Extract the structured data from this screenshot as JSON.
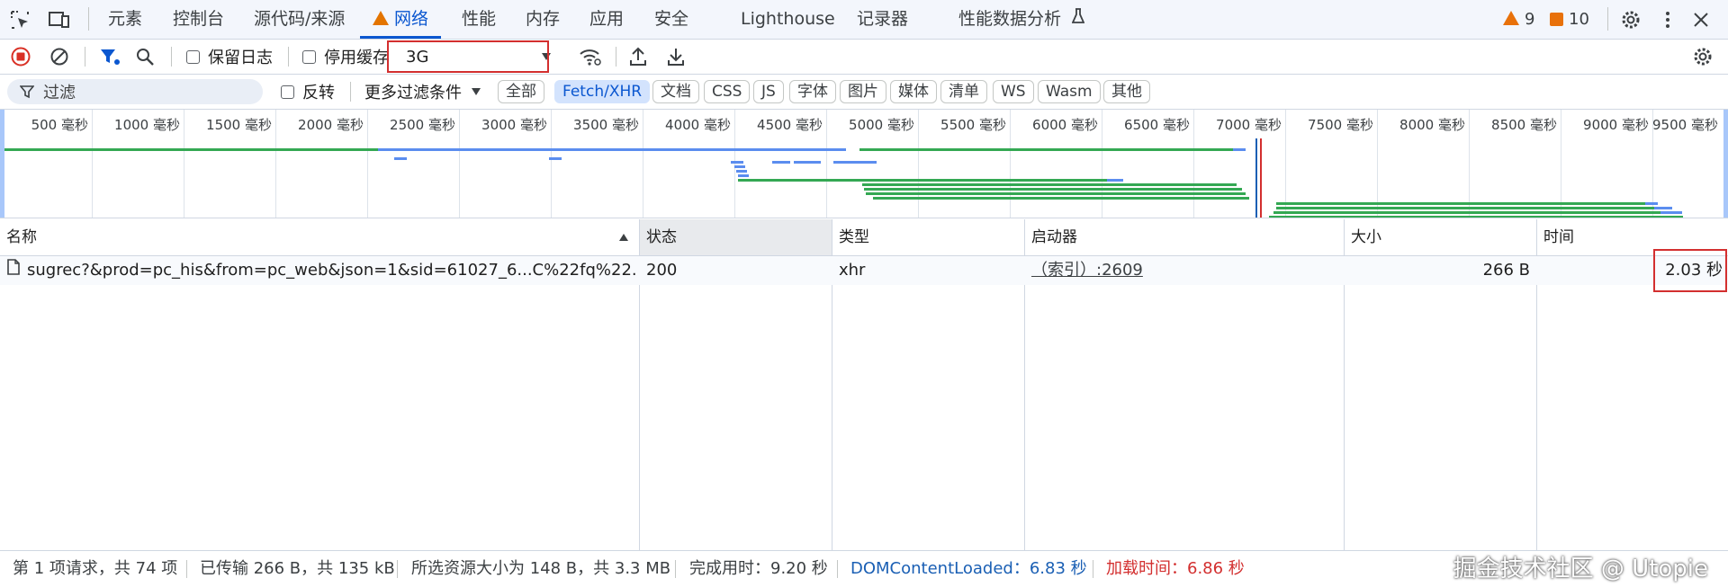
{
  "tabs": {
    "items": [
      {
        "label": "元素"
      },
      {
        "label": "控制台"
      },
      {
        "label": "源代码/来源"
      },
      {
        "label": "网络"
      },
      {
        "label": "性能"
      },
      {
        "label": "内存"
      },
      {
        "label": "应用"
      },
      {
        "label": "安全"
      },
      {
        "label": "Lighthouse"
      },
      {
        "label": "记录器"
      },
      {
        "label": "性能数据分析"
      }
    ],
    "active_tab": "网络",
    "warnings_count": "9",
    "issues_count": "10"
  },
  "toolbar": {
    "preserve_log_label": "保留日志",
    "disable_cache_label": "停用缓存",
    "throttling_value": "3G"
  },
  "filterbar": {
    "filter_placeholder": "过滤",
    "invert_label": "反转",
    "more_filters_label": "更多过滤条件",
    "type_chips": [
      {
        "label": "全部",
        "active": false
      },
      {
        "label": "Fetch/XHR",
        "active": true
      },
      {
        "label": "文档",
        "active": false
      },
      {
        "label": "CSS",
        "active": false
      },
      {
        "label": "JS",
        "active": false
      },
      {
        "label": "字体",
        "active": false
      },
      {
        "label": "图片",
        "active": false
      },
      {
        "label": "媒体",
        "active": false
      },
      {
        "label": "清单",
        "active": false
      },
      {
        "label": "WS",
        "active": false
      },
      {
        "label": "Wasm",
        "active": false
      },
      {
        "label": "其他",
        "active": false
      }
    ]
  },
  "overview": {
    "ticks": [
      "500 毫秒",
      "1000 毫秒",
      "1500 毫秒",
      "2000 毫秒",
      "2500 毫秒",
      "3000 毫秒",
      "3500 毫秒",
      "4000 毫秒",
      "4500 毫秒",
      "5000 毫秒",
      "5500 毫秒",
      "6000 毫秒",
      "6500 毫秒",
      "7000 毫秒",
      "7500 毫秒",
      "8000 毫秒",
      "8500 毫秒",
      "9000 毫秒",
      "9500 毫秒"
    ]
  },
  "table": {
    "columns": {
      "name": "名称",
      "status": "状态",
      "type": "类型",
      "initiator": "启动器",
      "size": "大小",
      "time": "时间"
    },
    "rows": [
      {
        "name": "sugrec?&prod=pc_his&from=pc_web&json=1&sid=61027_6...C%22fq%22...",
        "status": "200",
        "type": "xhr",
        "initiator": "（索引）:2609",
        "size": "266 B",
        "time": "2.03 秒"
      }
    ]
  },
  "statusbar": {
    "requests": "第 1 项请求，共 74 项",
    "transferred": "已传输 266 B，共 135 kB",
    "resources": "所选资源大小为 148 B，共 3.3 MB",
    "finish": "完成用时：9.20 秒",
    "dom_content_loaded": "DOMContentLoaded：6.83 秒",
    "load": "加载时间：6.86 秒",
    "watermark": "掘金技术社区 @ Utopie"
  },
  "colors": {
    "accent": "#0b57d0",
    "record_red": "#d93025",
    "dcl_blue": "#1a5fb4",
    "load_red": "#d32f2f",
    "waterfall_green": "#34a853",
    "waterfall_blue": "#5b8def"
  }
}
